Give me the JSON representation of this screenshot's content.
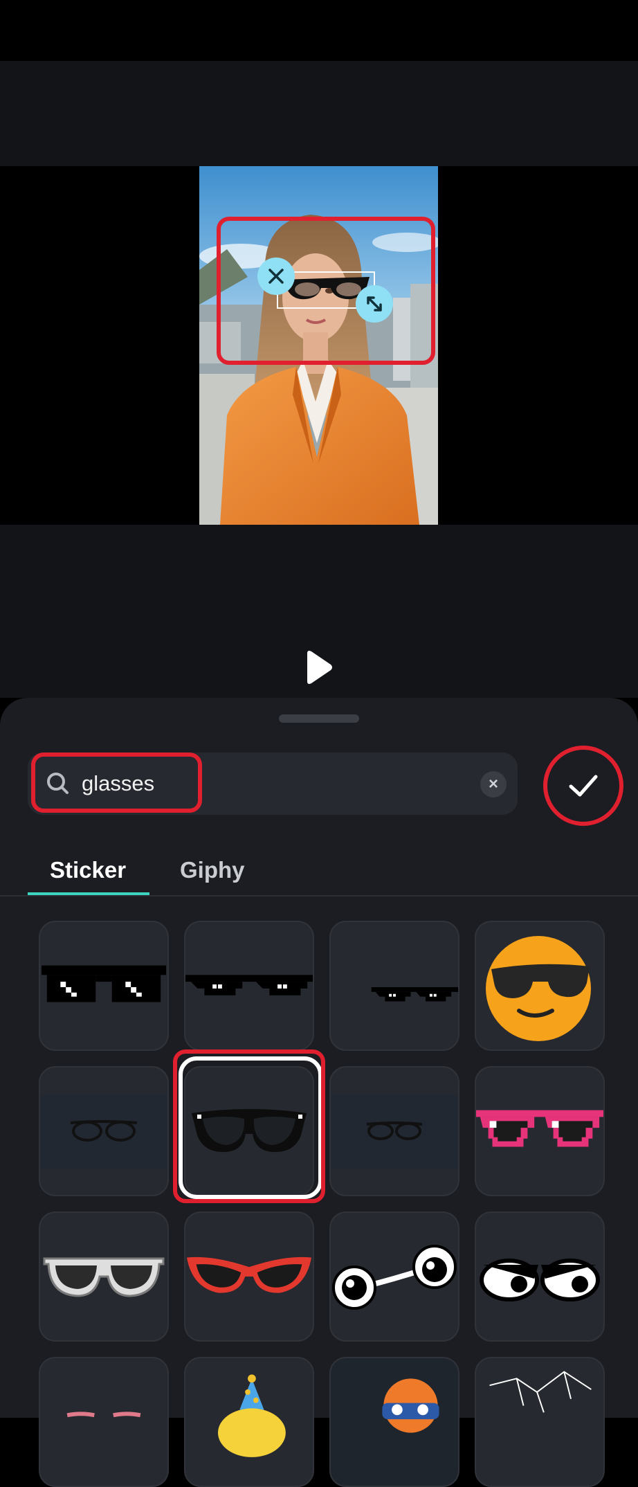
{
  "search": {
    "query": "glasses"
  },
  "tabs": [
    {
      "label": "Sticker",
      "active": true
    },
    {
      "label": "Giphy",
      "active": false
    }
  ],
  "colors": {
    "accent": "#3ed5c0",
    "highlight": "#e0202e",
    "panel": "#1b1d22",
    "tile": "#26292f",
    "handle_icon": "#8fe0f5"
  },
  "canvas": {
    "sticker_icons": [
      "close-icon",
      "resize-icon"
    ]
  },
  "stickers": [
    "pixel-deal-with-it-glasses",
    "pixel-sunglasses-wide",
    "pixel-sunglasses-small",
    "emoji-sunglasses-smiley",
    "thin-black-glasses",
    "black-frame-glasses-selected",
    "thin-glasses-small",
    "pink-pixel-glasses",
    "white-frame-glasses",
    "red-cat-eye-sunglasses",
    "googly-eyes",
    "angry-cartoon-eyes",
    "pink-glasses-partial",
    "party-hat-emoji",
    "orange-emoji-glasses",
    "cracked-glass"
  ]
}
